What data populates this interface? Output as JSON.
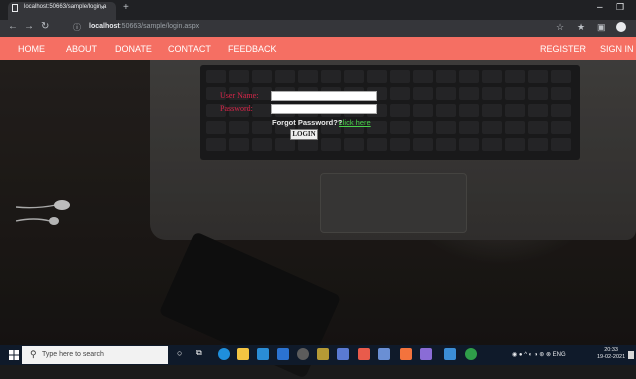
{
  "browser": {
    "tab_title": "localhost:50663/sample/login.a",
    "url_host": "localhost",
    "url_rest": ":50663/sample/login.aspx",
    "new_tab": "+",
    "tab_close": "×"
  },
  "nav": {
    "left": [
      "HOME",
      "ABOUT",
      "DONATE",
      "CONTACT",
      "FEEDBACK"
    ],
    "right": [
      "REGISTER",
      "SIGN IN"
    ]
  },
  "form": {
    "username_label": "User Name:",
    "password_label": "Password:",
    "forgot_text": "Forgot Password??",
    "click_here": "click here",
    "login_button": "LOGIN"
  },
  "taskbar": {
    "search_placeholder": "Type here to search",
    "lang": "ENG",
    "time": "20:33",
    "date": "19-02-2021"
  },
  "colors": {
    "navbar": "#f56f63",
    "label_red": "#d9264a",
    "link_green": "#49d24a"
  }
}
